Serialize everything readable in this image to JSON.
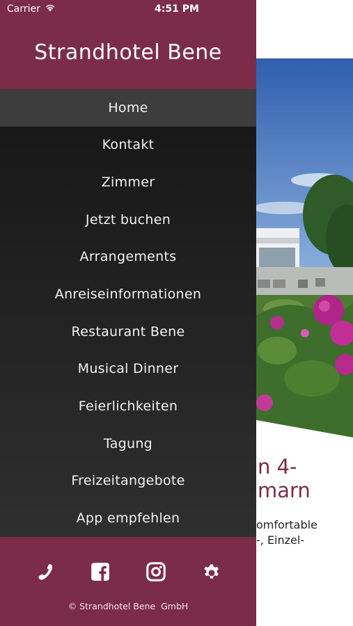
{
  "status_bar": {
    "carrier": "Carrier",
    "time": "4:51 PM"
  },
  "drawer": {
    "title": "Strandhotel Bene",
    "menu": [
      {
        "label": "Home",
        "active": true
      },
      {
        "label": "Kontakt"
      },
      {
        "label": "Zimmer"
      },
      {
        "label": "Jetzt buchen"
      },
      {
        "label": "Arrangements"
      },
      {
        "label": "Anreiseinformationen"
      },
      {
        "label": "Restaurant Bene"
      },
      {
        "label": "Musical Dinner"
      },
      {
        "label": "Feierlichkeiten"
      },
      {
        "label": "Tagung"
      },
      {
        "label": "Freizeitangebote"
      },
      {
        "label": "App empfehlen"
      }
    ],
    "footer": {
      "icons": [
        "phone-icon",
        "facebook-icon",
        "instagram-icon",
        "gear-icon"
      ],
      "copyright": "© Strandhotel Bene  GmbH"
    }
  },
  "background_page": {
    "heading_lines": [
      "n 4-",
      "marn"
    ],
    "body_lines": [
      "omfortable",
      "-, Einzel-"
    ]
  },
  "colors": {
    "brand": "#7b2c48",
    "menu_bg": "#1c1c1c",
    "menu_active": "#3d3d3d",
    "text_light": "#ffffff"
  }
}
